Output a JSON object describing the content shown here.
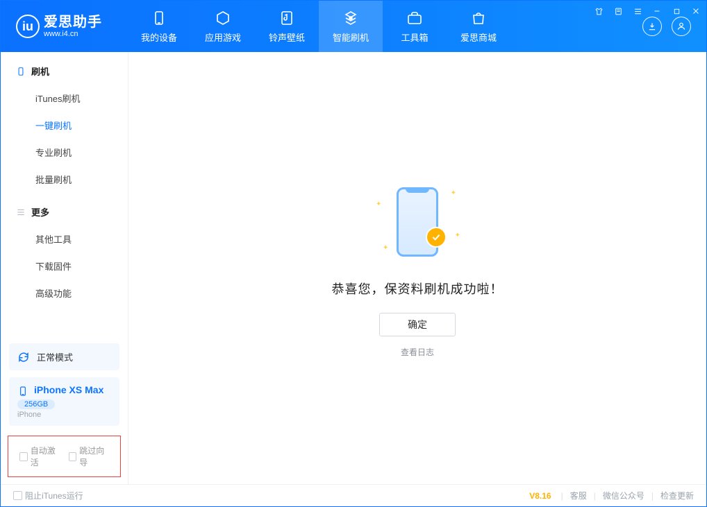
{
  "brand": {
    "title": "爱思助手",
    "subtitle": "www.i4.cn"
  },
  "nav": [
    {
      "label": "我的设备",
      "icon": "device-icon"
    },
    {
      "label": "应用游戏",
      "icon": "apps-icon"
    },
    {
      "label": "铃声壁纸",
      "icon": "ringtone-icon"
    },
    {
      "label": "智能刷机",
      "icon": "flash-icon",
      "active": true
    },
    {
      "label": "工具箱",
      "icon": "toolbox-icon"
    },
    {
      "label": "爱思商城",
      "icon": "store-icon"
    }
  ],
  "sidebar": {
    "section1": {
      "title": "刷机"
    },
    "items1": [
      {
        "label": "iTunes刷机"
      },
      {
        "label": "一键刷机",
        "active": true
      },
      {
        "label": "专业刷机"
      },
      {
        "label": "批量刷机"
      }
    ],
    "section2": {
      "title": "更多"
    },
    "items2": [
      {
        "label": "其他工具"
      },
      {
        "label": "下载固件"
      },
      {
        "label": "高级功能"
      }
    ],
    "mode_label": "正常模式",
    "device": {
      "name": "iPhone XS Max",
      "capacity": "256GB",
      "type": "iPhone"
    },
    "opt_auto_activate": "自动激活",
    "opt_skip_guide": "跳过向导"
  },
  "main": {
    "success_text": "恭喜您，保资料刷机成功啦！",
    "ok_label": "确定",
    "log_link": "查看日志"
  },
  "footer": {
    "block_itunes": "阻止iTunes运行",
    "version": "V8.16",
    "links": [
      "客服",
      "微信公众号",
      "检查更新"
    ]
  }
}
